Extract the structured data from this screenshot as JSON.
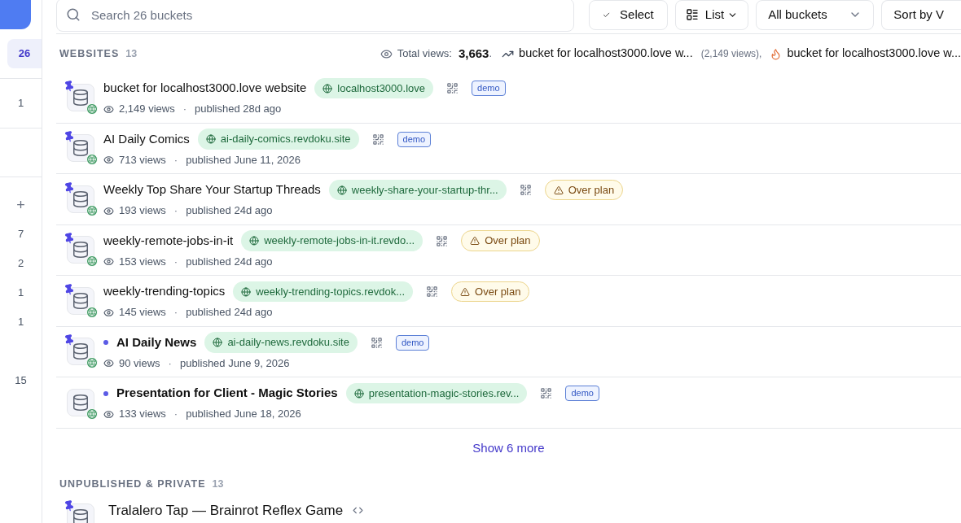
{
  "sidebar": {
    "groups": [
      [
        {
          "kind": "count",
          "label": "26",
          "selected": true
        }
      ],
      [
        {
          "kind": "count",
          "label": "1",
          "selected": false
        }
      ],
      [
        {
          "kind": "add",
          "label": "+"
        },
        {
          "kind": "count",
          "label": "7",
          "selected": false
        },
        {
          "kind": "count",
          "label": "2",
          "selected": false
        },
        {
          "kind": "count",
          "label": "1",
          "selected": false
        },
        {
          "kind": "count",
          "label": "1",
          "selected": false
        }
      ],
      [
        {
          "kind": "count",
          "label": "15",
          "selected": false
        }
      ]
    ]
  },
  "toolbar": {
    "search": {
      "placeholder": "Search 26 buckets"
    },
    "select_button": "Select",
    "view_button": "List",
    "filter": "All buckets",
    "sort": "Sort by V"
  },
  "sections": [
    {
      "title": "WEBSITES",
      "count": "13",
      "stats": {
        "label": "Total views:",
        "total": "3,663",
        "separator": ".",
        "top_name": "bucket for localhost3000.love w...",
        "top_views": "(2,149 views),",
        "hot_name": "bucket for localhost3000.love w..."
      },
      "meta_separator": "·",
      "items": [
        {
          "name": "bucket for localhost3000.love website",
          "pinned": true,
          "unread": false,
          "kind": "website",
          "domain": "localhost3000.love",
          "badge": {
            "kind": "demo",
            "label": "demo"
          },
          "views": "2,149 views",
          "published": "published 28d ago"
        },
        {
          "name": "AI Daily Comics",
          "pinned": true,
          "unread": false,
          "kind": "website",
          "domain": "ai-daily-comics.revdoku.site",
          "badge": {
            "kind": "demo",
            "label": "demo"
          },
          "views": "713 views",
          "published": "published June 11, 2026"
        },
        {
          "name": "Weekly Top Share Your Startup Threads",
          "pinned": true,
          "unread": false,
          "kind": "website",
          "domain": "weekly-share-your-startup-thr...",
          "badge": {
            "kind": "warning",
            "label": "Over plan"
          },
          "views": "193 views",
          "published": "published 24d ago"
        },
        {
          "name": "weekly-remote-jobs-in-it",
          "pinned": true,
          "unread": false,
          "kind": "website",
          "domain": "weekly-remote-jobs-in-it.revdo...",
          "badge": {
            "kind": "warning",
            "label": "Over plan"
          },
          "views": "153 views",
          "published": "published 24d ago"
        },
        {
          "name": "weekly-trending-topics",
          "pinned": true,
          "unread": false,
          "kind": "website",
          "domain": "weekly-trending-topics.revdok...",
          "badge": {
            "kind": "warning",
            "label": "Over plan"
          },
          "views": "145 views",
          "published": "published 24d ago"
        },
        {
          "name": "AI Daily News",
          "pinned": true,
          "unread": true,
          "kind": "website",
          "domain": "ai-daily-news.revdoku.site",
          "badge": {
            "kind": "demo",
            "label": "demo"
          },
          "views": "90 views",
          "published": "published June 9, 2026"
        },
        {
          "name": "Presentation for Client - Magic Stories",
          "pinned": false,
          "unread": true,
          "kind": "website",
          "domain": "presentation-magic-stories.rev...",
          "badge": {
            "kind": "demo",
            "label": "demo"
          },
          "views": "133 views",
          "published": "published June 18, 2026"
        }
      ],
      "more": "Show 6 more"
    },
    {
      "title": "UNPUBLISHED & PRIVATE",
      "count": "13",
      "items": [
        {
          "name": "Tralalero Tap — Brainrot Reflex Game",
          "pinned": true,
          "unread": false,
          "kind": "code"
        }
      ]
    }
  ]
}
